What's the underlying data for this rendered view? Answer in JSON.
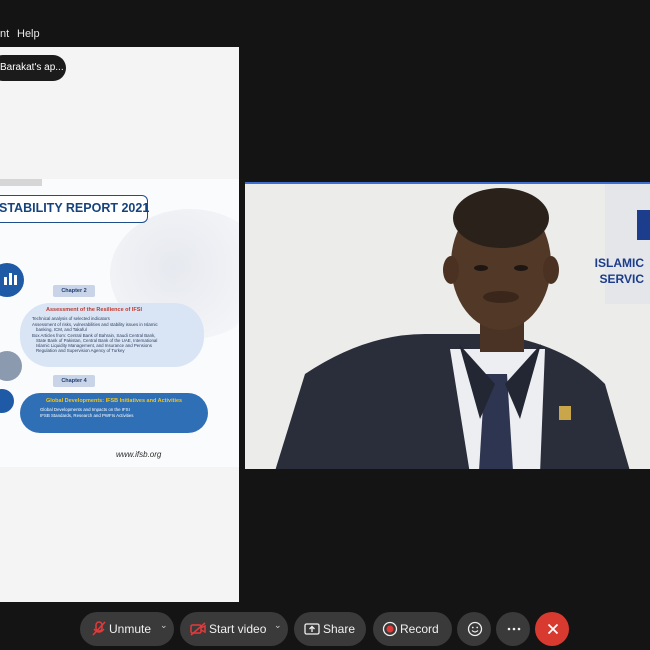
{
  "menubar": {
    "items": [
      "nt",
      "Help"
    ]
  },
  "share_panel": {
    "notification": "Barakat's ap..."
  },
  "slide": {
    "title": "STABILITY REPORT 2021",
    "chapter_2_label": "Chapter 2",
    "chapter_2_title": "Assessment of the Resilience of IFSI",
    "chapter_2_bullets": [
      "Technical analysis of selected indicators",
      "Assessment of risks, vulnerabilities and stability issues in Islamic",
      "banking, ICM, and Takaful",
      "Box Articles from: Central Bank of Bahrain, Saudi Central Bank,",
      "State Bank of Pakistan, Central Bank of the UAE, International",
      "Islamic Liquidity Management, and Insurance and Pensions",
      "Regulation and Supervision Agency of Turkey"
    ],
    "chapter_4_label": "Chapter 4",
    "chapter_4_title": "Global Developments: IFSB Initiatives and Activities",
    "chapter_4_bullets": [
      "Global Developments and Impacts on the IFSI",
      "IFSB Standards, Research and PWFIs Activities"
    ],
    "url": "www.ifsb.org"
  },
  "video": {
    "org_line_1": "ISLAMIC",
    "org_line_2": "SERVIC"
  },
  "toolbar": {
    "unmute": "Unmute",
    "start_video": "Start video",
    "share": "Share",
    "record": "Record"
  },
  "colors": {
    "background": "#141414",
    "accent": "#3e6fd0",
    "end_button": "#d93a30",
    "slide_blue": "#15437e"
  },
  "icons": [
    "mic-muted-icon",
    "video-off-icon",
    "share-screen-icon",
    "record-icon",
    "reaction-icon",
    "more-icon",
    "close-icon"
  ]
}
